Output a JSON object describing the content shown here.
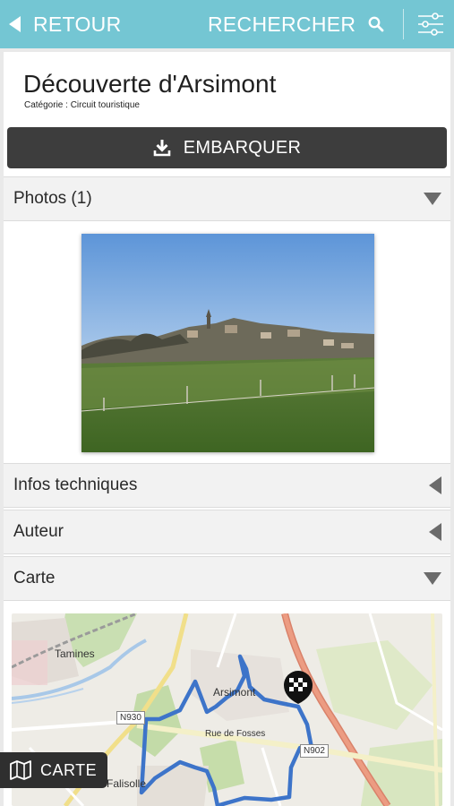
{
  "header": {
    "back_label": "RETOUR",
    "search_label": "RECHERCHER",
    "bar_color": "#74c6d3"
  },
  "detail": {
    "title": "Découverte d'Arsimont",
    "category": "Catégorie : Circuit touristique",
    "embark_label": "EMBARQUER"
  },
  "sections": {
    "photos": {
      "label": "Photos (1)",
      "state": "expanded"
    },
    "infos": {
      "label": "Infos techniques",
      "state": "collapsed"
    },
    "auteur": {
      "label": "Auteur",
      "state": "collapsed"
    },
    "carte": {
      "label": "Carte",
      "state": "expanded"
    }
  },
  "map": {
    "places": {
      "tamines": "Tamines",
      "arsimont": "Arsimont",
      "falisolle": "Falisolle"
    },
    "roads": {
      "n930": "N930",
      "fosses": "Rue de Fosses",
      "n902": "N902"
    },
    "route_color": "#3d74c9"
  },
  "floating": {
    "carte_button": "CARTE"
  }
}
